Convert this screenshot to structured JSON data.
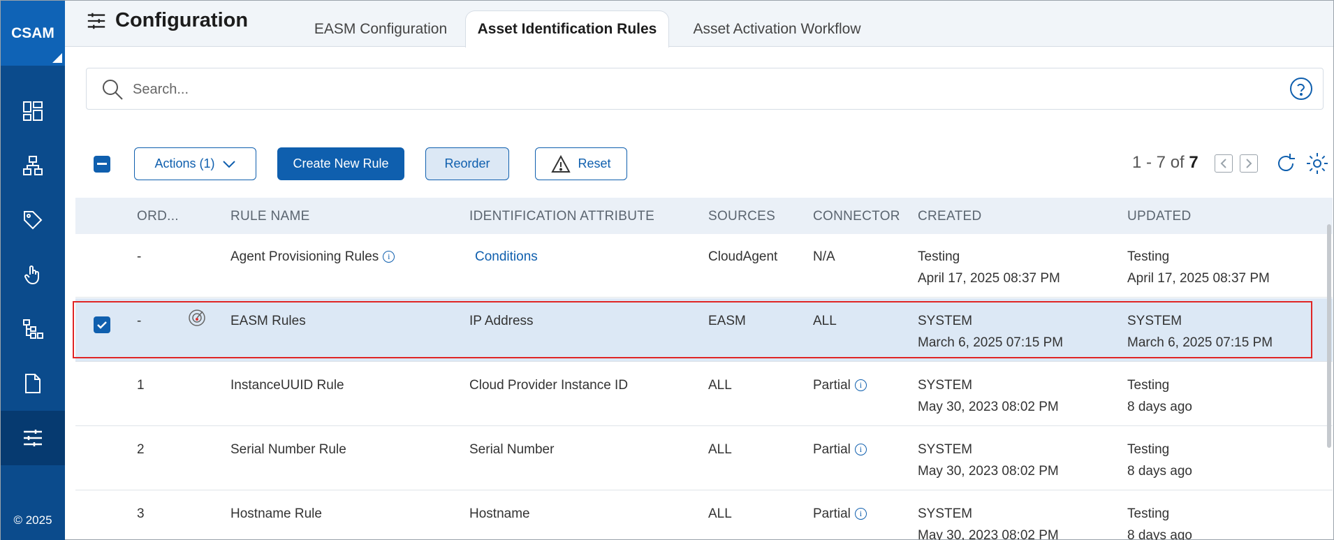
{
  "sidebar": {
    "brand": "CSAM",
    "copyright": "© 2025",
    "items": [
      {
        "icon": "dashboard-icon"
      },
      {
        "icon": "inventory-icon"
      },
      {
        "icon": "tag-icon"
      },
      {
        "icon": "touch-icon"
      },
      {
        "icon": "hierarchy-icon"
      },
      {
        "icon": "document-icon"
      },
      {
        "icon": "settings-sliders-icon",
        "active": true
      }
    ]
  },
  "header": {
    "title": "Configuration",
    "tabs": [
      {
        "label": "EASM Configuration"
      },
      {
        "label": "Asset Identification Rules",
        "active": true
      },
      {
        "label": "Asset Activation Workflow"
      }
    ]
  },
  "search": {
    "placeholder": "Search..."
  },
  "toolbar": {
    "actions_label": "Actions (1)",
    "create_label": "Create New Rule",
    "reorder_label": "Reorder",
    "reset_label": "Reset",
    "pager_range": "1 - 7 of ",
    "pager_total": "7"
  },
  "table": {
    "headers": {
      "order": "ORD...",
      "rule_name": "RULE NAME",
      "attribute": "IDENTIFICATION ATTRIBUTE",
      "sources": "SOURCES",
      "connector": "CONNECTOR",
      "created": "CREATED",
      "updated": "UPDATED"
    },
    "rows": [
      {
        "order": "-",
        "name": "Agent Provisioning Rules",
        "attribute": "Conditions",
        "sources": "CloudAgent",
        "connector": "N/A",
        "created_by": "Testing",
        "created_at": "April 17, 2025 08:37 PM",
        "updated_by": "Testing",
        "updated_at": "April 17, 2025 08:37 PM"
      },
      {
        "order": "-",
        "name": "EASM Rules",
        "attribute": "IP Address",
        "sources": "EASM",
        "connector": "ALL",
        "created_by": "SYSTEM",
        "created_at": "March 6, 2025 07:15 PM",
        "updated_by": "SYSTEM",
        "updated_at": "March 6, 2025 07:15 PM",
        "selected": true
      },
      {
        "order": "1",
        "name": "InstanceUUID Rule",
        "attribute": "Cloud Provider Instance ID",
        "sources": "ALL",
        "connector": "Partial",
        "created_by": "SYSTEM",
        "created_at": "May 30, 2023 08:02 PM",
        "updated_by": "Testing",
        "updated_at": "8 days ago"
      },
      {
        "order": "2",
        "name": "Serial Number Rule",
        "attribute": "Serial Number",
        "sources": "ALL",
        "connector": "Partial",
        "created_by": "SYSTEM",
        "created_at": "May 30, 2023 08:02 PM",
        "updated_by": "Testing",
        "updated_at": "8 days ago"
      },
      {
        "order": "3",
        "name": "Hostname Rule",
        "attribute": "Hostname",
        "sources": "ALL",
        "connector": "Partial",
        "created_by": "SYSTEM",
        "created_at": "May 30, 2023 08:02 PM",
        "updated_by": "Testing",
        "updated_at": "8 days ago"
      }
    ]
  },
  "colors": {
    "primary": "#0f5fae",
    "sidebar": "#0b4b8c",
    "selected_row": "#dce8f5",
    "highlight": "#e02525"
  }
}
